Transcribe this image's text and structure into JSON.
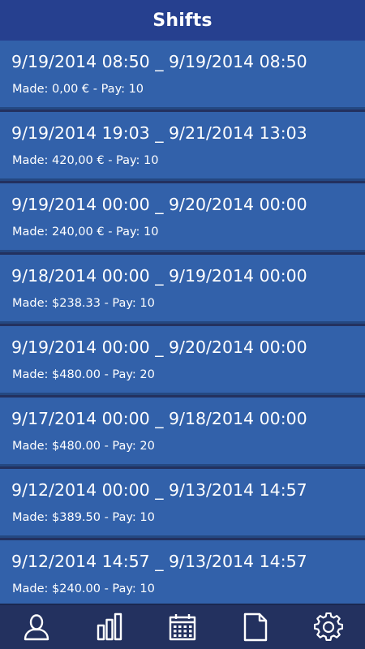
{
  "header": {
    "title": "Shifts"
  },
  "shifts": [
    {
      "range": "9/19/2014 08:50 _ 9/19/2014 08:50",
      "detail": "Made: 0,00 € - Pay: 10"
    },
    {
      "range": "9/19/2014 19:03 _ 9/21/2014 13:03",
      "detail": "Made: 420,00 € - Pay: 10"
    },
    {
      "range": "9/19/2014 00:00 _ 9/20/2014 00:00",
      "detail": "Made: 240,00 € - Pay: 10"
    },
    {
      "range": "9/18/2014 00:00 _ 9/19/2014 00:00",
      "detail": "Made: $238.33 - Pay: 10"
    },
    {
      "range": "9/19/2014 00:00 _ 9/20/2014 00:00",
      "detail": "Made: $480.00 - Pay: 20"
    },
    {
      "range": "9/17/2014 00:00 _ 9/18/2014 00:00",
      "detail": "Made: $480.00 - Pay: 20"
    },
    {
      "range": "9/12/2014 00:00 _ 9/13/2014 14:57",
      "detail": "Made: $389.50 - Pay: 10"
    },
    {
      "range": "9/12/2014 14:57 _ 9/13/2014 14:57",
      "detail": "Made: $240.00 - Pay: 10"
    }
  ],
  "tabbar": {
    "items": [
      {
        "icon": "user-icon"
      },
      {
        "icon": "bar-chart-icon"
      },
      {
        "icon": "calendar-icon"
      },
      {
        "icon": "document-icon"
      },
      {
        "icon": "gear-icon"
      }
    ]
  },
  "colors": {
    "header_bg": "#26408f",
    "row_bg": "#3261aa",
    "row_divider": "#244882",
    "tabbar_bg": "#23315f",
    "text": "#ffffff"
  }
}
